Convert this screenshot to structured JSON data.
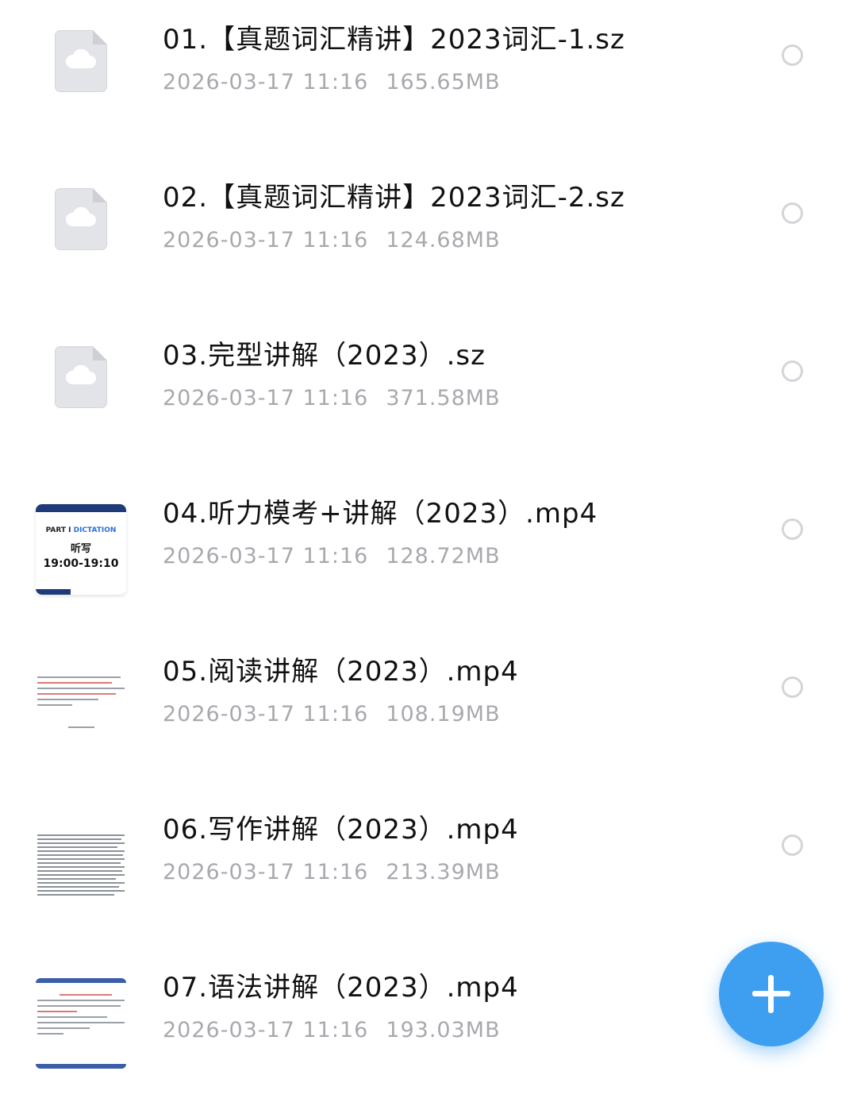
{
  "files": [
    {
      "name": "01.【真题词汇精讲】2023词汇-1.sz",
      "date": "2026-03-17  11:16",
      "size": "165.65MB",
      "thumbnail": "cloud-file-icon"
    },
    {
      "name": "02.【真题词汇精讲】2023词汇-2.sz",
      "date": "2026-03-17  11:16",
      "size": "124.68MB",
      "thumbnail": "cloud-file-icon"
    },
    {
      "name": "03.完型讲解（2023）.sz",
      "date": "2026-03-17  11:16",
      "size": "371.58MB",
      "thumbnail": "cloud-file-icon"
    },
    {
      "name": "04.听力模考+讲解（2023）.mp4",
      "date": "2026-03-17  11:16",
      "size": "128.72MB",
      "thumbnail": "video-thumbnail",
      "thumb_text": {
        "part": "PART I",
        "section": "DICTATION",
        "title": "听写",
        "time": "19:00-19:10"
      }
    },
    {
      "name": "05.阅读讲解（2023）.mp4",
      "date": "2026-03-17  11:16",
      "size": "108.19MB",
      "thumbnail": "video-thumbnail"
    },
    {
      "name": "06.写作讲解（2023）.mp4",
      "date": "2026-03-17  11:16",
      "size": "213.39MB",
      "thumbnail": "video-thumbnail"
    },
    {
      "name": "07.语法讲解（2023）.mp4",
      "date": "2026-03-17  11:16",
      "size": "193.03MB",
      "thumbnail": "video-thumbnail"
    }
  ],
  "fab": {
    "icon": "plus-icon",
    "color": "#3e9ff0"
  }
}
